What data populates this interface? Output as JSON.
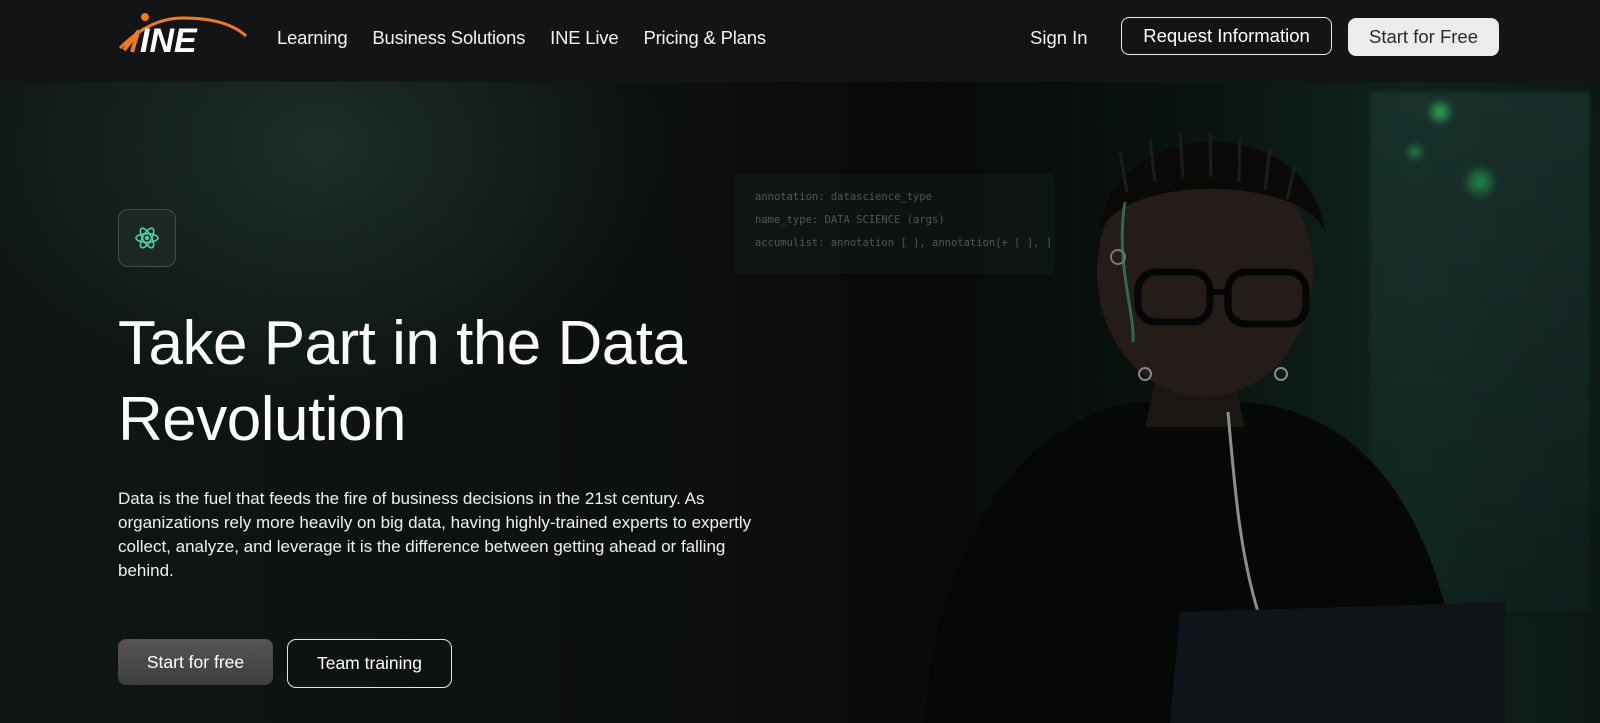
{
  "brand": {
    "logo_text": "INE",
    "accent_color": "#f07a1e"
  },
  "nav": {
    "items": [
      {
        "label": "Learning"
      },
      {
        "label": "Business Solutions"
      },
      {
        "label": "INE Live"
      },
      {
        "label": "Pricing & Plans"
      }
    ],
    "sign_in": "Sign In",
    "request_info": "Request Information",
    "start_free": "Start for Free"
  },
  "hero": {
    "icon": "atom-icon",
    "title": "Take Part in the Data Revolution",
    "description": "Data is the fuel that feeds the fire of business decisions in the 21st century. As organizations rely more heavily on big data, having highly-trained experts to expertly collect, analyze, and leverage it is the difference between getting ahead or falling behind.",
    "primary_cta": "Start for free",
    "secondary_cta": "Team training",
    "code_lines": [
      "annotation: datascience_type",
      "name_type: DATA SCIENCE (args)",
      "accumulist: annotation [ ], annotation[+ [ ], ]"
    ]
  }
}
